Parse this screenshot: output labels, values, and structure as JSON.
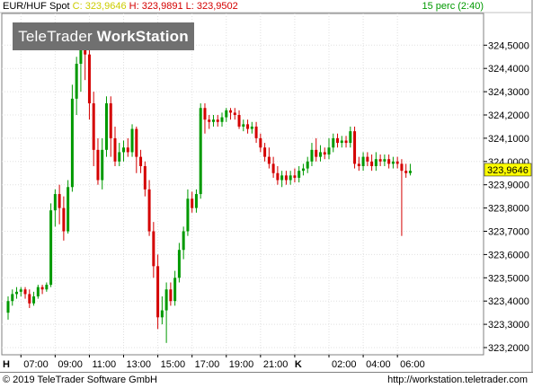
{
  "header": {
    "symbol": "EUR/HUF Spot",
    "close": "C: 323,9646",
    "high_low": "H: 323,9891  L: 323,9502",
    "interval": "15 perc (2:40)"
  },
  "watermark": {
    "brand": "TeleTrader",
    "product": "WorkStation"
  },
  "footer": {
    "copyright": "© 2019 TeleTrader Software GmbH",
    "url": "http://workstation.teletrader.com"
  },
  "colors": {
    "up": "#009900",
    "down": "#d40000",
    "grid": "#e0e0e0",
    "current_price_bg": "#ffff00"
  },
  "chart_data": {
    "type": "candlestick",
    "title": "",
    "ylim": [
      323.2,
      324.6
    ],
    "y_ticks": [
      "324,5000",
      "324,4000",
      "324,3000",
      "324,2000",
      "324,1000",
      "324,0000",
      "323,9000",
      "323,8000",
      "323,7000",
      "323,6000",
      "323,5000",
      "323,4000",
      "323,3000",
      "323,2000"
    ],
    "x_axis_prefix": "H",
    "x_ticks": [
      {
        "label": "07:00",
        "i": 3
      },
      {
        "label": "09:00",
        "i": 11
      },
      {
        "label": "11:00",
        "i": 19
      },
      {
        "label": "13:00",
        "i": 27
      },
      {
        "label": "15:00",
        "i": 35
      },
      {
        "label": "17:00",
        "i": 43
      },
      {
        "label": "19:00",
        "i": 51
      },
      {
        "label": "21:00",
        "i": 59
      },
      {
        "label": "K",
        "i": 67
      },
      {
        "label": "02:00",
        "i": 75
      },
      {
        "label": "04:00",
        "i": 83
      },
      {
        "label": "06:00",
        "i": 91
      }
    ],
    "current_price": "323,9646",
    "candles": [
      [
        323.35,
        323.4,
        323.32,
        323.42
      ],
      [
        323.4,
        323.43,
        323.38,
        323.45
      ],
      [
        323.43,
        323.44,
        323.41,
        323.46
      ],
      [
        323.44,
        323.45,
        323.42,
        323.46
      ],
      [
        323.45,
        323.43,
        323.41,
        323.46
      ],
      [
        323.43,
        323.39,
        323.37,
        323.45
      ],
      [
        323.39,
        323.42,
        323.38,
        323.44
      ],
      [
        323.42,
        323.46,
        323.41,
        323.47
      ],
      [
        323.46,
        323.45,
        323.43,
        323.47
      ],
      [
        323.45,
        323.47,
        323.44,
        323.48
      ],
      [
        323.47,
        323.79,
        323.46,
        323.82
      ],
      [
        323.79,
        323.86,
        323.72,
        323.88
      ],
      [
        323.86,
        323.8,
        323.73,
        323.9
      ],
      [
        323.8,
        323.7,
        323.66,
        323.85
      ],
      [
        323.7,
        323.89,
        323.69,
        323.92
      ],
      [
        323.89,
        324.27,
        323.87,
        324.33
      ],
      [
        324.27,
        324.42,
        324.2,
        324.45
      ],
      [
        324.42,
        324.55,
        324.3,
        324.58
      ],
      [
        324.55,
        324.46,
        324.35,
        324.54
      ],
      [
        324.46,
        324.25,
        324.18,
        324.5
      ],
      [
        324.25,
        324.05,
        323.98,
        324.3
      ],
      [
        324.05,
        323.92,
        323.9,
        324.1
      ],
      [
        323.92,
        324.05,
        323.88,
        324.1
      ],
      [
        324.05,
        324.25,
        324.02,
        324.28
      ],
      [
        324.25,
        324.1,
        324.02,
        324.28
      ],
      [
        324.1,
        324.0,
        323.98,
        324.15
      ],
      [
        324.0,
        324.04,
        323.98,
        324.08
      ],
      [
        324.04,
        324.06,
        324.0,
        324.09
      ],
      [
        324.06,
        324.04,
        324.02,
        324.1
      ],
      [
        324.04,
        324.14,
        324.02,
        324.16
      ],
      [
        324.14,
        324.02,
        323.95,
        324.15
      ],
      [
        324.02,
        323.98,
        323.95,
        324.05
      ],
      [
        323.98,
        323.88,
        323.85,
        324.0
      ],
      [
        323.88,
        323.7,
        323.68,
        323.92
      ],
      [
        323.7,
        323.55,
        323.5,
        323.74
      ],
      [
        323.55,
        323.33,
        323.28,
        323.6
      ],
      [
        323.33,
        323.36,
        323.3,
        323.42
      ],
      [
        323.36,
        323.45,
        323.22,
        323.48
      ],
      [
        323.45,
        323.4,
        323.38,
        323.48
      ],
      [
        323.4,
        323.5,
        323.38,
        323.53
      ],
      [
        323.5,
        323.62,
        323.48,
        323.65
      ],
      [
        323.62,
        323.7,
        323.58,
        323.72
      ],
      [
        323.7,
        323.84,
        323.68,
        323.88
      ],
      [
        323.84,
        323.8,
        323.78,
        323.87
      ],
      [
        323.8,
        323.86,
        323.78,
        323.88
      ],
      [
        323.86,
        324.23,
        323.84,
        324.25
      ],
      [
        324.23,
        324.18,
        324.12,
        324.25
      ],
      [
        324.18,
        324.17,
        324.14,
        324.2
      ],
      [
        324.17,
        324.18,
        324.15,
        324.2
      ],
      [
        324.18,
        324.17,
        324.15,
        324.2
      ],
      [
        324.17,
        324.19,
        324.15,
        324.21
      ],
      [
        324.19,
        324.22,
        324.17,
        324.23
      ],
      [
        324.22,
        324.21,
        324.18,
        324.23
      ],
      [
        324.21,
        324.2,
        324.18,
        324.23
      ],
      [
        324.2,
        324.15,
        324.14,
        324.22
      ],
      [
        324.15,
        324.16,
        324.13,
        324.18
      ],
      [
        324.16,
        324.14,
        324.12,
        324.18
      ],
      [
        324.14,
        324.15,
        324.12,
        324.17
      ],
      [
        324.15,
        324.1,
        324.08,
        324.17
      ],
      [
        324.1,
        324.06,
        324.04,
        324.12
      ],
      [
        324.06,
        324.02,
        324.0,
        324.08
      ],
      [
        324.02,
        323.99,
        323.97,
        324.06
      ],
      [
        323.99,
        323.95,
        323.93,
        324.02
      ],
      [
        323.95,
        323.92,
        323.9,
        323.98
      ],
      [
        323.92,
        323.94,
        323.89,
        323.96
      ],
      [
        323.94,
        323.92,
        323.9,
        323.96
      ],
      [
        323.92,
        323.94,
        323.9,
        323.96
      ],
      [
        323.94,
        323.93,
        323.91,
        323.97
      ],
      [
        323.93,
        323.96,
        323.91,
        323.98
      ],
      [
        323.96,
        323.97,
        323.94,
        323.99
      ],
      [
        323.97,
        324.0,
        323.95,
        324.02
      ],
      [
        324.0,
        324.05,
        323.98,
        324.08
      ],
      [
        324.05,
        324.02,
        324.0,
        324.1
      ],
      [
        324.02,
        324.04,
        324.0,
        324.07
      ],
      [
        324.04,
        324.03,
        324.01,
        324.06
      ],
      [
        324.03,
        324.06,
        324.01,
        324.1
      ],
      [
        324.06,
        324.1,
        324.04,
        324.12
      ],
      [
        324.1,
        324.08,
        324.06,
        324.12
      ],
      [
        324.08,
        324.09,
        324.06,
        324.11
      ],
      [
        324.09,
        324.08,
        324.06,
        324.11
      ],
      [
        324.08,
        324.13,
        324.06,
        324.15
      ],
      [
        324.13,
        323.99,
        323.97,
        324.15
      ],
      [
        323.99,
        323.98,
        323.96,
        324.02
      ],
      [
        323.98,
        324.02,
        323.96,
        324.04
      ],
      [
        324.02,
        324.0,
        323.98,
        324.04
      ],
      [
        324.0,
        323.98,
        323.96,
        324.03
      ],
      [
        323.98,
        324.01,
        323.96,
        324.04
      ],
      [
        324.01,
        324.0,
        323.98,
        324.03
      ],
      [
        324.0,
        324.01,
        323.98,
        324.03
      ],
      [
        324.01,
        323.99,
        323.97,
        324.03
      ],
      [
        323.99,
        324.0,
        323.97,
        324.02
      ],
      [
        324.0,
        323.99,
        323.97,
        324.02
      ],
      [
        323.99,
        323.96,
        323.68,
        324.01
      ],
      [
        323.96,
        323.95,
        323.93,
        323.99
      ],
      [
        323.95,
        323.96,
        323.94,
        323.99
      ]
    ]
  }
}
